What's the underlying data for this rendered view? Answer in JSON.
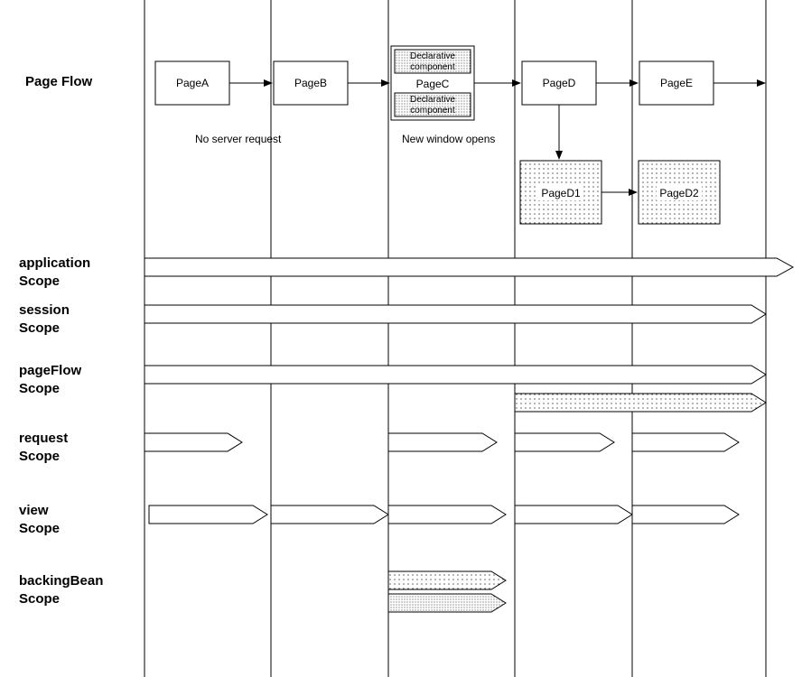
{
  "title": "Page Flow",
  "pages": {
    "a": "PageA",
    "b": "PageB",
    "c": "PageC",
    "d": "PageD",
    "e": "PageE",
    "d1": "PageD1",
    "d2": "PageD2"
  },
  "decl": {
    "top": "Declarative component",
    "bottom": "Declarative component"
  },
  "notes": {
    "noServer": "No server request",
    "newWindow": "New window opens"
  },
  "scopes": {
    "application": {
      "l1": "application",
      "l2": "Scope"
    },
    "session": {
      "l1": "session",
      "l2": "Scope"
    },
    "pageFlow": {
      "l1": "pageFlow",
      "l2": "Scope"
    },
    "request": {
      "l1": "request",
      "l2": "Scope"
    },
    "view": {
      "l1": "view",
      "l2": "Scope"
    },
    "backingBean": {
      "l1": "backingBean",
      "l2": "Scope"
    }
  }
}
